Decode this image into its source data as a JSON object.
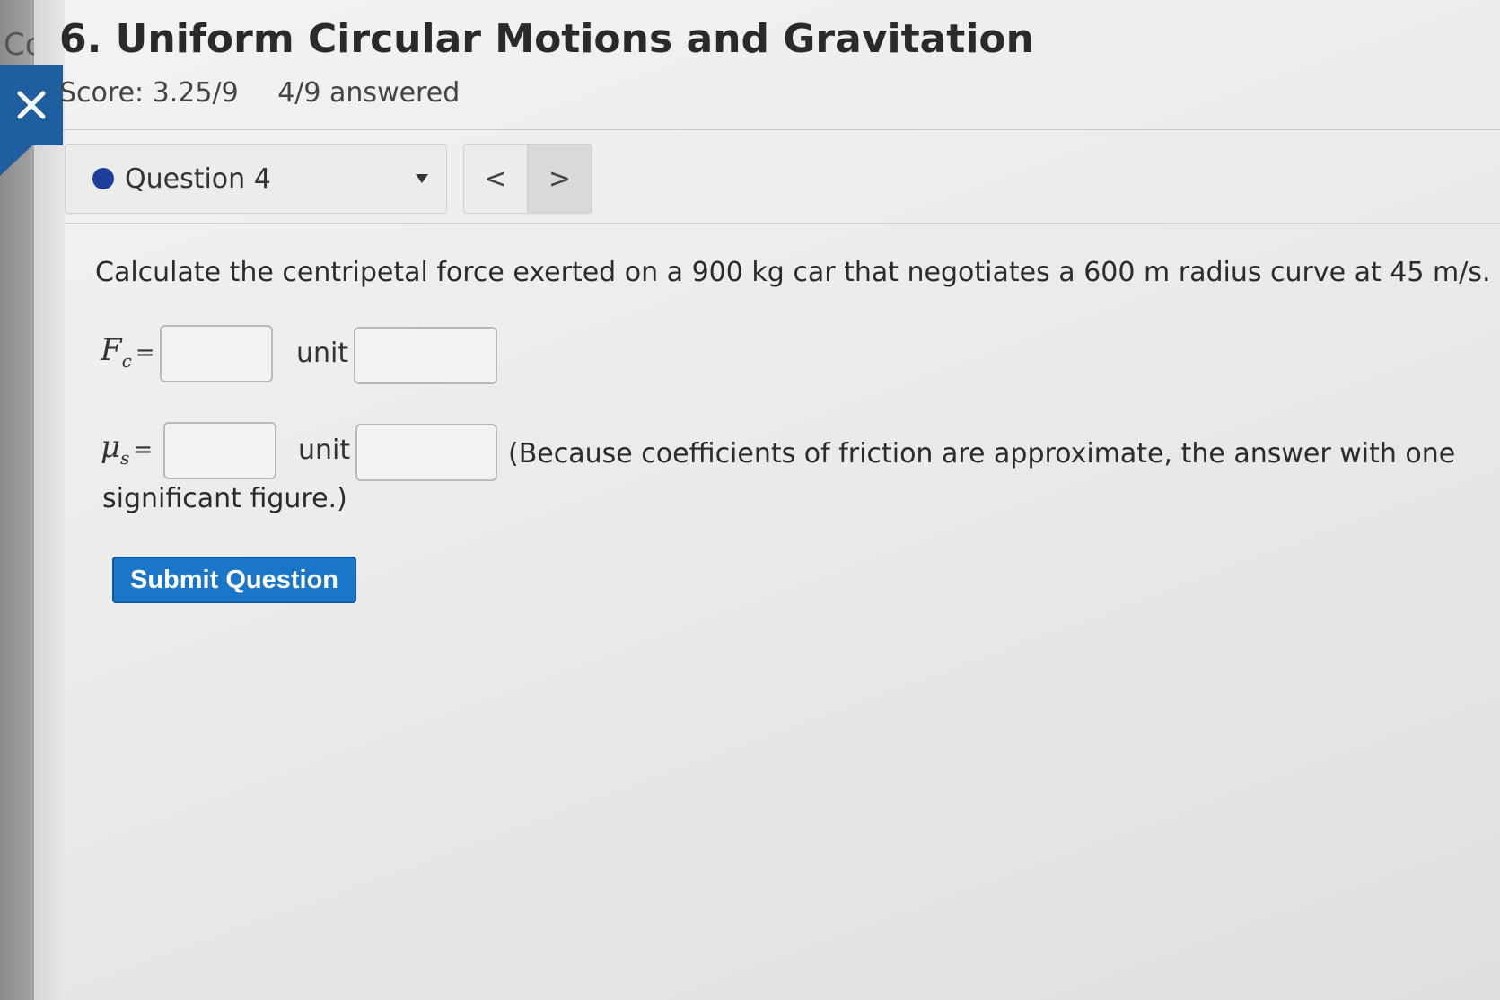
{
  "sidebar": {
    "cut_text": "Co"
  },
  "header": {
    "title": "6. Uniform Circular Motions and Gravitation",
    "score": "Score: 3.25/9",
    "answered": "4/9 answered"
  },
  "question_nav": {
    "selected_question": "Question 4",
    "prev_symbol": "<",
    "next_symbol": ">",
    "status_color": "#1d3f9c"
  },
  "question": {
    "prompt": "Calculate the centripetal force exerted on a 900 kg car that negotiates a 600 m radius curve at 45 m/s.",
    "fields": [
      {
        "symbol": "F",
        "subscript": "c",
        "equals": "=",
        "value": "",
        "unit_label": "unit",
        "unit_value": ""
      },
      {
        "symbol": "μ",
        "subscript": "s",
        "equals": "=",
        "value": "",
        "unit_label": "unit",
        "unit_value": ""
      }
    ],
    "note_line1": "(Because coefficients of friction are approximate, the answer with one",
    "note_line2": "significant figure.)"
  },
  "actions": {
    "submit_label": "Submit Question",
    "accent": "#1976c9"
  }
}
